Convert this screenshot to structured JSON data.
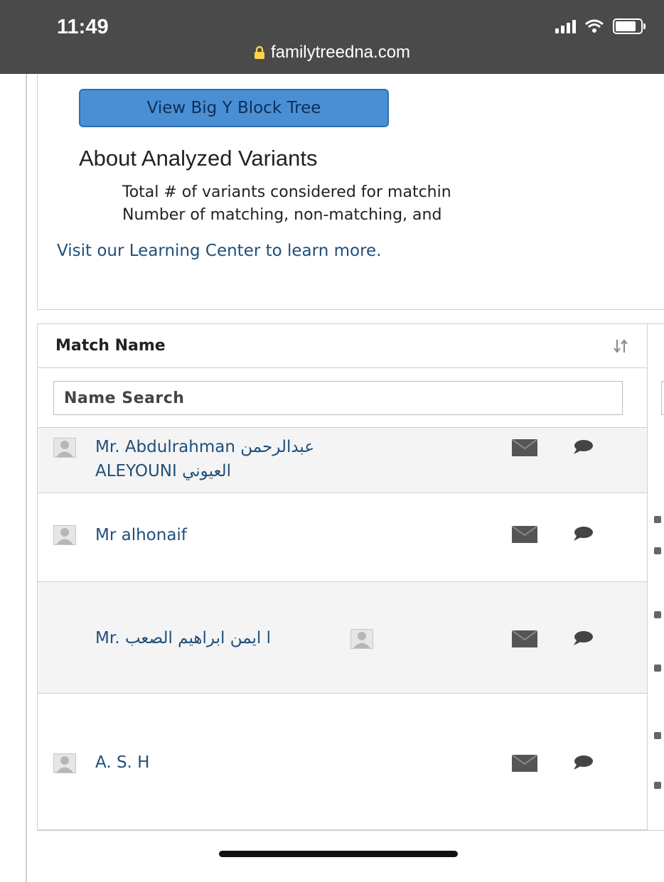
{
  "status_bar": {
    "time": "11:49"
  },
  "url_bar": {
    "domain": "familytreedna.com"
  },
  "actions": {
    "block_tree_button": "View Big Y Block Tree"
  },
  "about": {
    "title": "About Analyzed Variants",
    "bullets": [
      "Total # of variants considered for matchin",
      "Number of matching, non-matching, and"
    ],
    "learn_more": "Visit our Learning Center to learn more."
  },
  "table": {
    "column_header": "Match Name",
    "search_placeholder": "Name Search",
    "rows": [
      {
        "name_line1": "Mr. Abdulrahman عبدالرحمن",
        "name_line2": "ALEYOUNI العيوني"
      },
      {
        "name_line1": "Mr alhonaif"
      },
      {
        "name_line1": "Mr. ا ايمن ابراهيم الصعب"
      },
      {
        "name_line1": "A. S. H"
      }
    ]
  },
  "icons": {
    "avatar": "user-avatar-icon",
    "mail": "mail-icon",
    "chat": "chat-bubble-icon",
    "sort": "sort-icon",
    "lock": "lock-icon"
  },
  "colors": {
    "top_bar": "#4a4a4a",
    "button_bg": "#4a8fd4",
    "link": "#1f4f7a",
    "row_alt": "#f4f4f4"
  }
}
